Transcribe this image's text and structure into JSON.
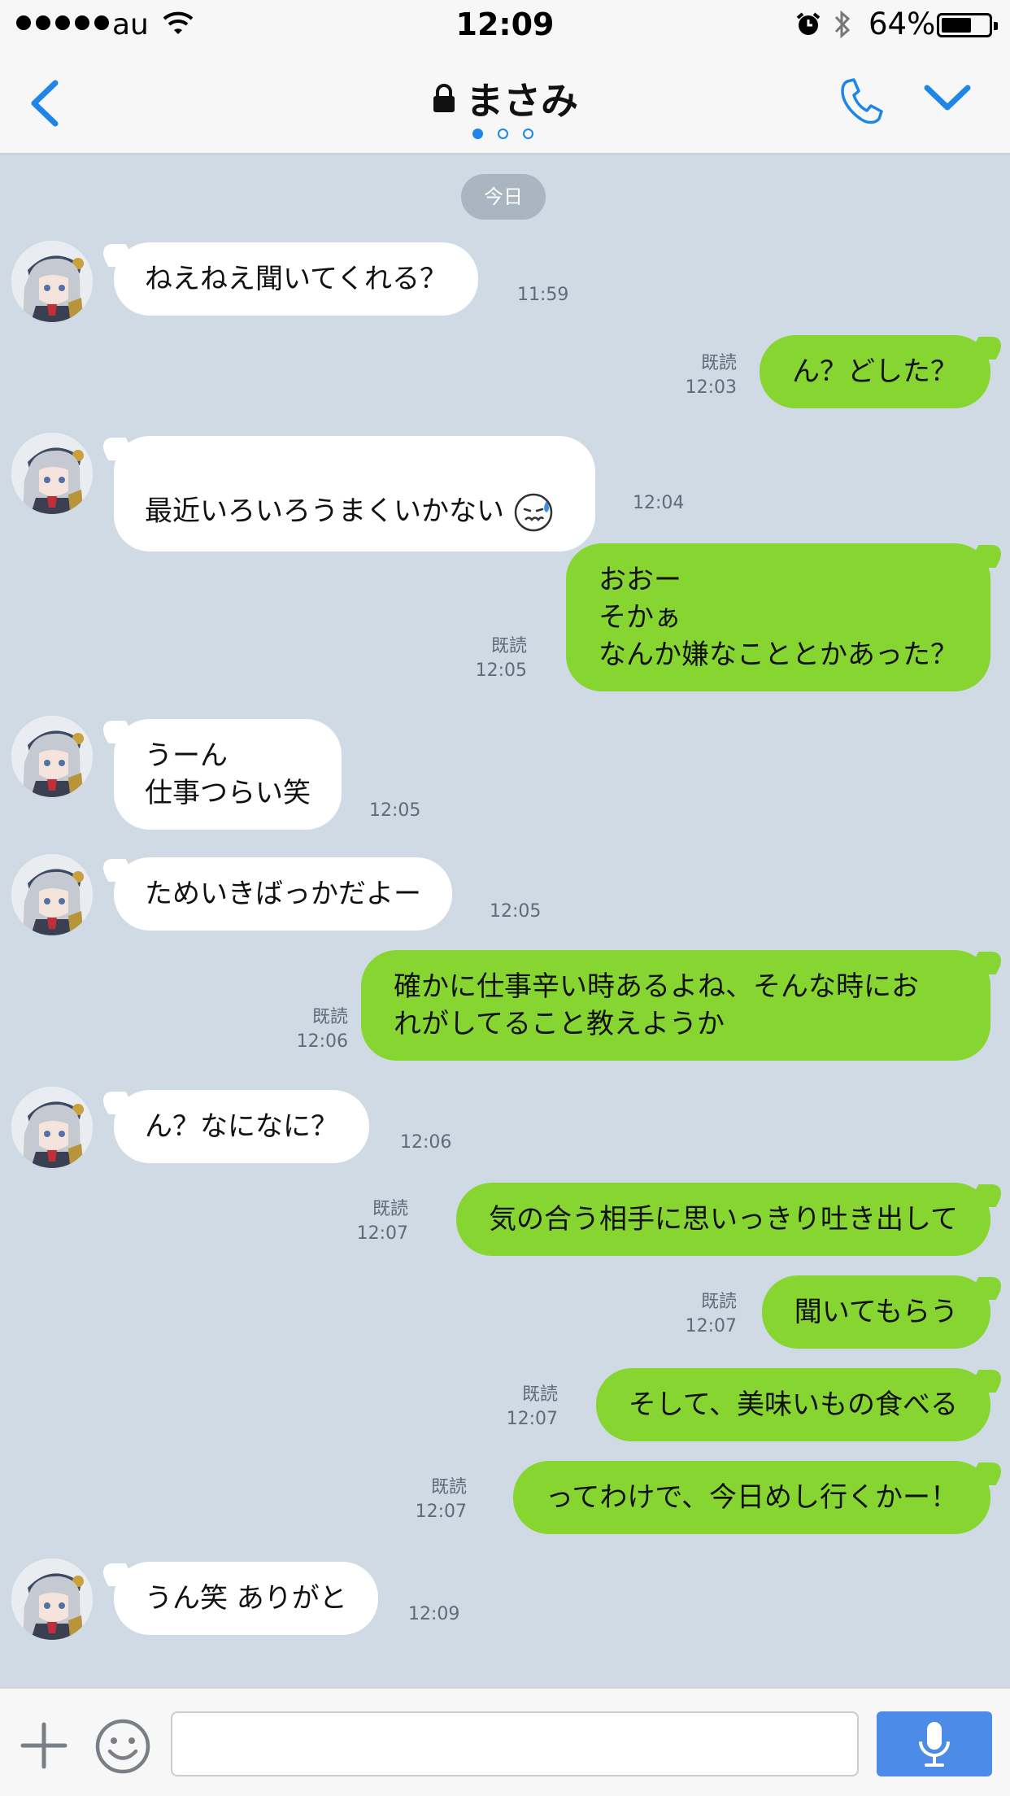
{
  "status_bar": {
    "carrier": "au",
    "time": "12:09",
    "battery_percent": "64%",
    "battery_level": 0.64,
    "icons": [
      "signal-dots-icon",
      "wifi-icon",
      "alarm-icon",
      "bluetooth-icon",
      "battery-icon"
    ]
  },
  "header": {
    "title": "まさみ",
    "page_dots": 3,
    "active_page": 1,
    "icons": [
      "back-chevron-icon",
      "lock-icon",
      "phone-icon",
      "chevron-down-icon"
    ]
  },
  "date_label": "今日",
  "messages": [
    {
      "side": "in",
      "text": "ねえねえ聞いてくれる？",
      "time": "11:59"
    },
    {
      "side": "out",
      "text": "ん？どした？",
      "read": "既読",
      "time": "12:03"
    },
    {
      "side": "in",
      "text": "最近いろいろうまくいかない",
      "emoji": "sweat-face-icon",
      "time": "12:04"
    },
    {
      "side": "out",
      "text": "おおー\nそかぁ\nなんか嫌なこととかあった？",
      "read": "既読",
      "time": "12:05"
    },
    {
      "side": "in",
      "text": "うーん\n仕事つらい笑",
      "time": "12:05"
    },
    {
      "side": "in",
      "text": "ためいきばっかだよー",
      "time": "12:05"
    },
    {
      "side": "out",
      "text": "確かに仕事辛い時あるよね、そんな時にお\nれがしてること教えようか",
      "read": "既読",
      "time": "12:06"
    },
    {
      "side": "in",
      "text": "ん？なになに？",
      "time": "12:06"
    },
    {
      "side": "out",
      "text": "気の合う相手に思いっきり吐き出して",
      "read": "既読",
      "time": "12:07"
    },
    {
      "side": "out",
      "text": "聞いてもらう",
      "read": "既読",
      "time": "12:07"
    },
    {
      "side": "out",
      "text": "そして、美味いもの食べる",
      "read": "既読",
      "time": "12:07"
    },
    {
      "side": "out",
      "text": "ってわけで、今日めし行くかー！",
      "read": "既読",
      "time": "12:07"
    },
    {
      "side": "in",
      "text": "うん笑 ありがと",
      "time": "12:09"
    }
  ],
  "input_bar": {
    "value": "",
    "icons": [
      "plus-icon",
      "smiley-icon",
      "microphone-icon"
    ]
  },
  "colors": {
    "chat_background": "#cfdae5",
    "outgoing_bubble": "#86d530",
    "incoming_bubble": "#ffffff",
    "accent": "#1e86e6",
    "mic_button": "#4c8be8"
  }
}
